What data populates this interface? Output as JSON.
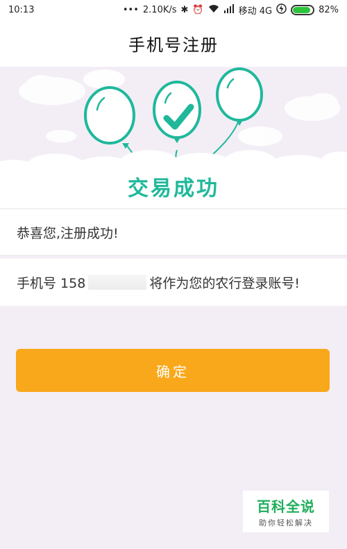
{
  "status_bar": {
    "time": "10:13",
    "dots": "•••",
    "speed": "2.10K/s",
    "network": "移动 4G",
    "battery": "82%",
    "icons": [
      "bluetooth-icon",
      "alarm-icon",
      "wifi-icon",
      "hd-signal-icon",
      "charging-icon",
      "battery-icon"
    ]
  },
  "header": {
    "title": "手机号注册"
  },
  "banner": {
    "title": "交易成功"
  },
  "messages": {
    "congrats": "恭喜您,注册成功!",
    "phone_prefix": "手机号 158",
    "phone_suffix": "将作为您的农行登录账号!"
  },
  "actions": {
    "confirm_label": "确定"
  },
  "watermark": {
    "brand": "百科全说",
    "slogan": "助你轻松解决"
  },
  "colors": {
    "accent": "#1fb89b",
    "button": "#f9a81b",
    "background": "#f3eef6"
  }
}
